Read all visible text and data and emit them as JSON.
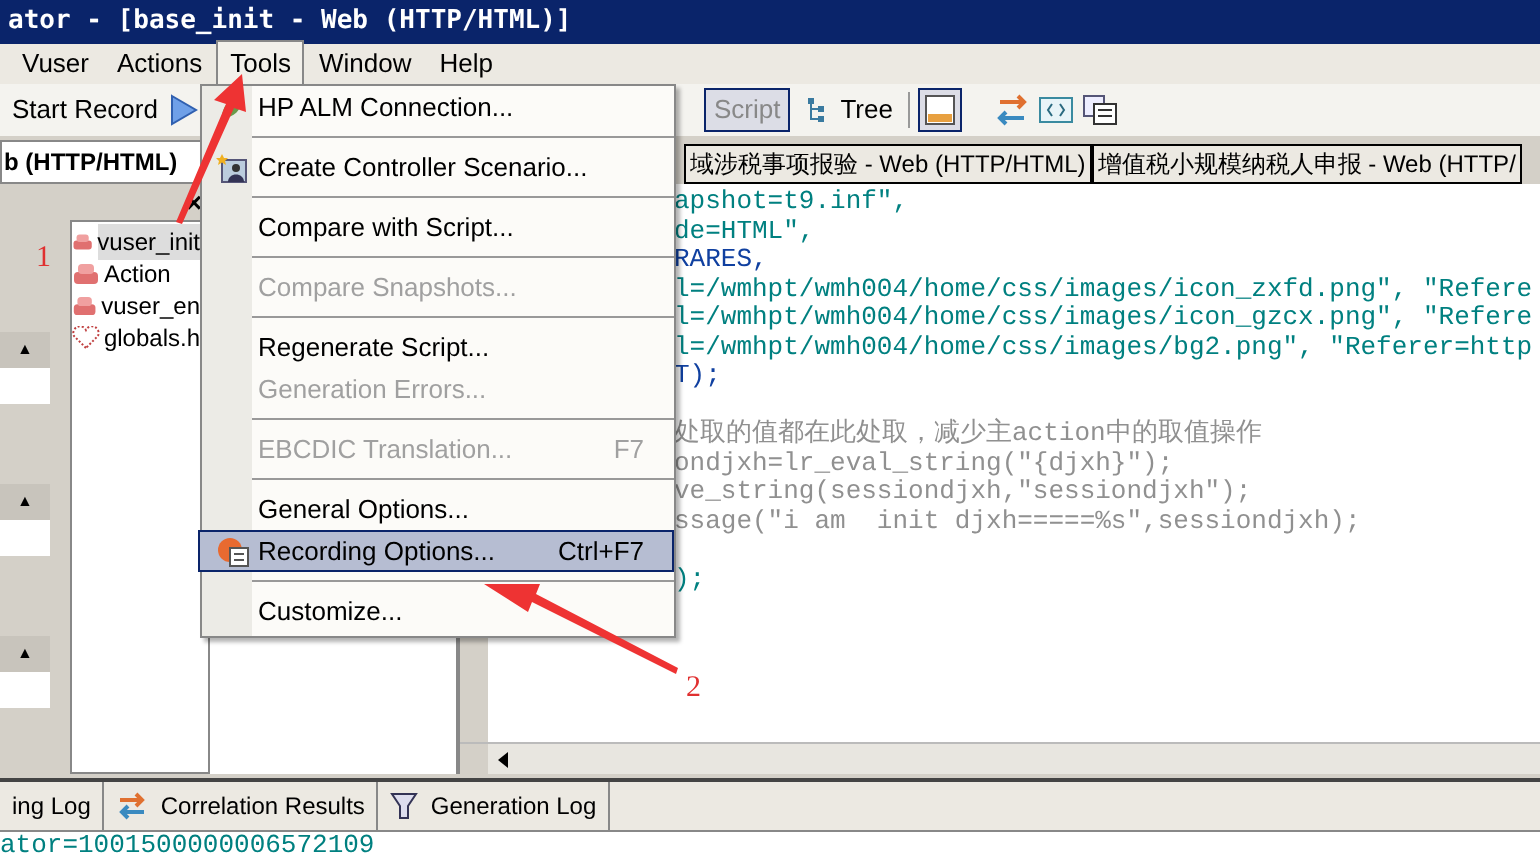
{
  "window": {
    "title": "ator - [base_init - Web (HTTP/HTML)]"
  },
  "menu_bar": [
    {
      "label": "Vuser",
      "selected": false
    },
    {
      "label": "Actions",
      "selected": false
    },
    {
      "label": "Tools",
      "selected": true
    },
    {
      "label": "Window",
      "selected": false
    },
    {
      "label": "Help",
      "selected": false
    }
  ],
  "toolbar": {
    "record": "Start Record",
    "script": "Script",
    "tree": "Tree"
  },
  "left_panel": {
    "title": "b (HTTP/HTML)",
    "close": "×",
    "sections": [
      {
        "toggle": "▲"
      },
      {
        "toggle": "▲"
      },
      {
        "toggle": "▲"
      }
    ],
    "files": [
      {
        "name": "vuser_init",
        "selected": true,
        "kind": "action"
      },
      {
        "name": "Action",
        "selected": false,
        "kind": "action"
      },
      {
        "name": "vuser_en",
        "selected": false,
        "kind": "action"
      },
      {
        "name": "globals.h",
        "selected": false,
        "kind": "header"
      }
    ]
  },
  "script_tabs": [
    {
      "label": "域涉税事项报验 - Web (HTTP/HTML)",
      "selected": false
    },
    {
      "label": "增值税小规模纳税人申报 - Web (HTTP/",
      "selected": false
    }
  ],
  "code_lines": [
    {
      "kind": "code",
      "text": "apshot=t9.inf\","
    },
    {
      "kind": "code",
      "text": "de=HTML\","
    },
    {
      "kind": "keyword",
      "text": "RARES,"
    },
    {
      "kind": "code",
      "text": "l=/wmhpt/wmh004/home/css/images/icon_zxfd.png\", \"Refere"
    },
    {
      "kind": "code",
      "text": "l=/wmhpt/wmh004/home/css/images/icon_gzcx.png\", \"Refere"
    },
    {
      "kind": "code",
      "text": "l=/wmhpt/wmh004/home/css/images/bg2.png\", \"Referer=http"
    },
    {
      "kind": "keyword",
      "text": "T);"
    },
    {
      "kind": "blank"
    },
    {
      "kind": "comment",
      "text": "处取的值都在此处取，减少主action中的取值操作"
    },
    {
      "kind": "comment",
      "text": "ondjxh=lr_eval_string(\"{djxh}\");"
    },
    {
      "kind": "comment",
      "text": "ve_string(sessiondjxh,\"sessiondjxh\");"
    },
    {
      "kind": "comment",
      "text": "ssage(\"i am  init djxh=====%s\",sessiondjxh);"
    },
    {
      "kind": "blank"
    },
    {
      "kind": "code",
      "text": ");"
    }
  ],
  "tools_menu": {
    "groups": [
      [
        {
          "label": "HP ALM Connection...",
          "disabled": false,
          "selected": false
        }
      ],
      [
        {
          "label": "Create Controller Scenario...",
          "disabled": false,
          "selected": false
        }
      ],
      [
        {
          "label": "Compare with Script...",
          "disabled": false,
          "selected": false
        }
      ],
      [
        {
          "label": "Compare Snapshots...",
          "disabled": true,
          "selected": false
        }
      ],
      [
        {
          "label": "Regenerate Script...",
          "disabled": false,
          "selected": false
        },
        {
          "label": "Generation Errors...",
          "disabled": true,
          "selected": false
        }
      ],
      [
        {
          "label": "EBCDIC Translation...",
          "shortcut": "F7",
          "disabled": true,
          "selected": false
        }
      ],
      [
        {
          "label": "General Options...",
          "disabled": false,
          "selected": false
        },
        {
          "label": "Recording Options...",
          "shortcut": "Ctrl+F7",
          "disabled": false,
          "selected": true
        }
      ],
      [
        {
          "label": "Customize...",
          "disabled": false,
          "selected": false
        }
      ]
    ]
  },
  "bottom_tabs": [
    {
      "label": "ing Log"
    },
    {
      "label": "Correlation Results"
    },
    {
      "label": "Generation Log"
    }
  ],
  "output_line": "ator=1001500000006572109",
  "annotations": [
    {
      "label": "1"
    },
    {
      "label": "2"
    }
  ]
}
